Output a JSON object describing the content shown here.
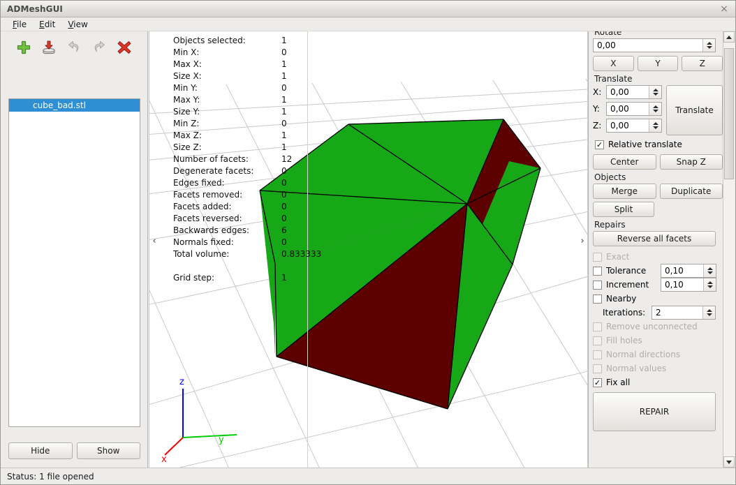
{
  "window": {
    "title": "ADMeshGUI",
    "close_label": "×"
  },
  "menu": [
    {
      "label": "File",
      "mnemonic": "F"
    },
    {
      "label": "Edit",
      "mnemonic": "E"
    },
    {
      "label": "View",
      "mnemonic": "V"
    }
  ],
  "toolbar": [
    {
      "name": "add-file-icon",
      "label": "Add"
    },
    {
      "name": "save-file-icon",
      "label": "Save"
    },
    {
      "name": "undo-icon",
      "label": "Undo"
    },
    {
      "name": "redo-icon",
      "label": "Redo"
    },
    {
      "name": "close-file-icon",
      "label": "Close"
    }
  ],
  "file_list": {
    "items": [
      {
        "name": "cube_bad.stl",
        "selected": true
      }
    ]
  },
  "left_buttons": {
    "hide": "Hide",
    "show": "Show"
  },
  "viewport": {
    "collapse_left": "‹",
    "collapse_right": "›",
    "axes": [
      {
        "label": "z",
        "color": "#0000ff"
      },
      {
        "label": "y",
        "color": "#00cc00"
      },
      {
        "label": "x",
        "color": "#ee0000"
      }
    ],
    "mesh_colors": {
      "front_facet": "#17a817",
      "back_facet": "#5c0000",
      "edge": "#000000",
      "grid": "#c8c8c8"
    }
  },
  "info": {
    "rows": [
      {
        "key": "Objects selected:",
        "value": "1"
      },
      {
        "key": "Min X:",
        "value": "0"
      },
      {
        "key": "Max X:",
        "value": "1"
      },
      {
        "key": "Size X:",
        "value": "1"
      },
      {
        "key": "Min Y:",
        "value": "0"
      },
      {
        "key": "Max Y:",
        "value": "1"
      },
      {
        "key": "Size Y:",
        "value": "1"
      },
      {
        "key": "Min Z:",
        "value": "0"
      },
      {
        "key": "Max Z:",
        "value": "1"
      },
      {
        "key": "Size Z:",
        "value": "1"
      },
      {
        "key": "Number of facets:",
        "value": "12"
      },
      {
        "key": "Degenerate facets:",
        "value": "0"
      },
      {
        "key": "Edges fixed:",
        "value": "0"
      },
      {
        "key": "Facets removed:",
        "value": "0"
      },
      {
        "key": "Facets added:",
        "value": "0"
      },
      {
        "key": "Facets reversed:",
        "value": "0"
      },
      {
        "key": "Backwards edges:",
        "value": "6"
      },
      {
        "key": "Normals fixed:",
        "value": "0"
      },
      {
        "key": "Total volume:",
        "value": "0.833333"
      },
      {
        "key": "",
        "value": ""
      },
      {
        "key": "Grid step:",
        "value": "1"
      }
    ]
  },
  "right_panel": {
    "rotate": {
      "title": "Rotate",
      "angle": "0,00",
      "axes": [
        "X",
        "Y",
        "Z"
      ]
    },
    "translate": {
      "title": "Translate",
      "fields": [
        {
          "axis": "X:",
          "value": "0,00"
        },
        {
          "axis": "Y:",
          "value": "0,00"
        },
        {
          "axis": "Z:",
          "value": "0,00"
        }
      ],
      "button": "Translate",
      "relative": {
        "label": "Relative translate",
        "checked": true
      },
      "center": "Center",
      "snapz": "Snap Z"
    },
    "objects": {
      "title": "Objects",
      "merge": "Merge",
      "duplicate": "Duplicate",
      "split": "Split"
    },
    "repairs": {
      "title": "Repairs",
      "reverse_all": "Reverse all facets",
      "checks": [
        {
          "label": "Exact",
          "checked": false,
          "enabled": false,
          "value": null
        },
        {
          "label": "Tolerance",
          "checked": false,
          "enabled": true,
          "value": "0,10"
        },
        {
          "label": "Increment",
          "checked": false,
          "enabled": true,
          "value": "0,10"
        },
        {
          "label": "Nearby",
          "checked": false,
          "enabled": true,
          "value": null
        }
      ],
      "iterations": {
        "label": "Iterations:",
        "value": "2"
      },
      "checks2": [
        {
          "label": "Remove unconnected",
          "checked": false,
          "enabled": false
        },
        {
          "label": "Fill holes",
          "checked": false,
          "enabled": false
        },
        {
          "label": "Normal directions",
          "checked": false,
          "enabled": false
        },
        {
          "label": "Normal values",
          "checked": false,
          "enabled": false
        },
        {
          "label": "Fix all",
          "checked": true,
          "enabled": true
        }
      ],
      "repair_button": "REPAIR"
    }
  },
  "status": {
    "text": "Status: 1 file opened"
  }
}
